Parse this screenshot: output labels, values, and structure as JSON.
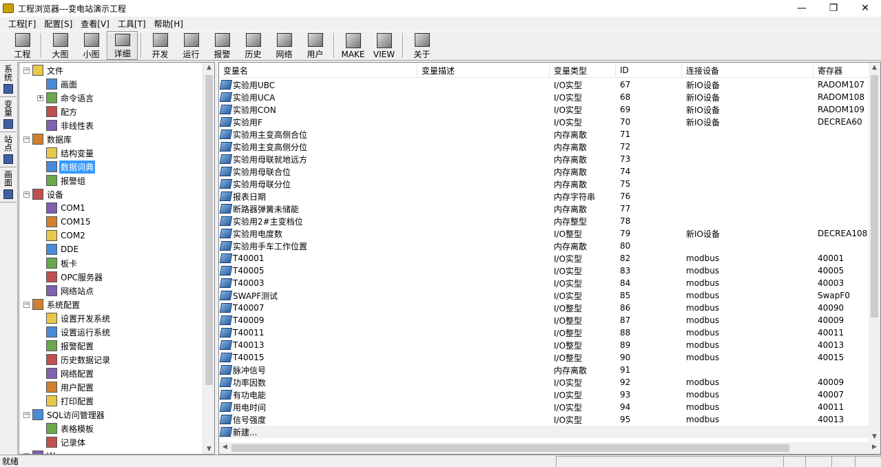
{
  "window": {
    "title": "工程浏览器---变电站演示工程",
    "min": "—",
    "max": "❐",
    "close": "✕"
  },
  "menu": [
    "工程[F]",
    "配置[S]",
    "查看[V]",
    "工具[T]",
    "帮助[H]"
  ],
  "toolbar": {
    "group1": [
      "工程"
    ],
    "group2": [
      "大图",
      "小图",
      "详细"
    ],
    "group3": [
      "开发",
      "运行",
      "报警",
      "历史",
      "网络",
      "用户"
    ],
    "group4": [
      "MAKE",
      "VIEW"
    ],
    "group5": [
      "关于"
    ],
    "active": "详细"
  },
  "side_tabs": [
    "系统",
    "变量",
    "站点",
    "画面"
  ],
  "tree": [
    {
      "label": "文件",
      "level": 0,
      "exp": "−",
      "sel": false
    },
    {
      "label": "画面",
      "level": 1,
      "exp": "",
      "sel": false
    },
    {
      "label": "命令语言",
      "level": 1,
      "exp": "+",
      "sel": false
    },
    {
      "label": "配方",
      "level": 1,
      "exp": "",
      "sel": false
    },
    {
      "label": "非线性表",
      "level": 1,
      "exp": "",
      "sel": false
    },
    {
      "label": "数据库",
      "level": 0,
      "exp": "−",
      "sel": false
    },
    {
      "label": "结构变量",
      "level": 1,
      "exp": "",
      "sel": false
    },
    {
      "label": "数据词典",
      "level": 1,
      "exp": "",
      "sel": true
    },
    {
      "label": "报警组",
      "level": 1,
      "exp": "",
      "sel": false
    },
    {
      "label": "设备",
      "level": 0,
      "exp": "−",
      "sel": false
    },
    {
      "label": "COM1",
      "level": 1,
      "exp": "",
      "sel": false
    },
    {
      "label": "COM15",
      "level": 1,
      "exp": "",
      "sel": false
    },
    {
      "label": "COM2",
      "level": 1,
      "exp": "",
      "sel": false
    },
    {
      "label": "DDE",
      "level": 1,
      "exp": "",
      "sel": false
    },
    {
      "label": "板卡",
      "level": 1,
      "exp": "",
      "sel": false
    },
    {
      "label": "OPC服务器",
      "level": 1,
      "exp": "",
      "sel": false
    },
    {
      "label": "网络站点",
      "level": 1,
      "exp": "",
      "sel": false
    },
    {
      "label": "系统配置",
      "level": 0,
      "exp": "−",
      "sel": false
    },
    {
      "label": "设置开发系统",
      "level": 1,
      "exp": "",
      "sel": false
    },
    {
      "label": "设置运行系统",
      "level": 1,
      "exp": "",
      "sel": false
    },
    {
      "label": "报警配置",
      "level": 1,
      "exp": "",
      "sel": false
    },
    {
      "label": "历史数据记录",
      "level": 1,
      "exp": "",
      "sel": false
    },
    {
      "label": "网络配置",
      "level": 1,
      "exp": "",
      "sel": false
    },
    {
      "label": "用户配置",
      "level": 1,
      "exp": "",
      "sel": false
    },
    {
      "label": "打印配置",
      "level": 1,
      "exp": "",
      "sel": false
    },
    {
      "label": "SQL访问管理器",
      "level": 0,
      "exp": "−",
      "sel": false
    },
    {
      "label": "表格模板",
      "level": 1,
      "exp": "",
      "sel": false
    },
    {
      "label": "记录体",
      "level": 1,
      "exp": "",
      "sel": false
    },
    {
      "label": "W...",
      "level": 0,
      "exp": "+",
      "sel": false
    }
  ],
  "table": {
    "columns": [
      "变量名",
      "变量描述",
      "变量类型",
      "ID",
      "连接设备",
      "寄存器"
    ],
    "rows": [
      [
        "实验用UBC",
        "",
        "I/O实型",
        "67",
        "新IO设备",
        "RADOM107"
      ],
      [
        "实验用UCA",
        "",
        "I/O实型",
        "68",
        "新IO设备",
        "RADOM108"
      ],
      [
        "实验用CON",
        "",
        "I/O实型",
        "69",
        "新IO设备",
        "RADOM109"
      ],
      [
        "实验用F",
        "",
        "I/O实型",
        "70",
        "新IO设备",
        "DECREA60"
      ],
      [
        "实验用主变高侧合位",
        "",
        "内存离散",
        "71",
        "",
        ""
      ],
      [
        "实验用主变高侧分位",
        "",
        "内存离散",
        "72",
        "",
        ""
      ],
      [
        "实验用母联就地远方",
        "",
        "内存离散",
        "73",
        "",
        ""
      ],
      [
        "实验用母联合位",
        "",
        "内存离散",
        "74",
        "",
        ""
      ],
      [
        "实验用母联分位",
        "",
        "内存离散",
        "75",
        "",
        ""
      ],
      [
        "报表日期",
        "",
        "内存字符串",
        "76",
        "",
        ""
      ],
      [
        "断路器弹簧未储能",
        "",
        "内存离散",
        "77",
        "",
        ""
      ],
      [
        "实验用2#主变档位",
        "",
        "内存整型",
        "78",
        "",
        ""
      ],
      [
        "实验用电度数",
        "",
        "I/O整型",
        "79",
        "新IO设备",
        "DECREA108"
      ],
      [
        "实验用手车工作位置",
        "",
        "内存离散",
        "80",
        "",
        ""
      ],
      [
        "T40001",
        "",
        "I/O实型",
        "82",
        "modbus",
        "40001"
      ],
      [
        "T40005",
        "",
        "I/O实型",
        "83",
        "modbus",
        "40005"
      ],
      [
        "T40003",
        "",
        "I/O实型",
        "84",
        "modbus",
        "40003"
      ],
      [
        "SWAPF测试",
        "",
        "I/O实型",
        "85",
        "modbus",
        "SwapF0"
      ],
      [
        "T40007",
        "",
        "I/O整型",
        "86",
        "modbus",
        "40090"
      ],
      [
        "T40009",
        "",
        "I/O整型",
        "87",
        "modbus",
        "40009"
      ],
      [
        "T40011",
        "",
        "I/O整型",
        "88",
        "modbus",
        "40011"
      ],
      [
        "T40013",
        "",
        "I/O整型",
        "89",
        "modbus",
        "40013"
      ],
      [
        "T40015",
        "",
        "I/O整型",
        "90",
        "modbus",
        "40015"
      ],
      [
        "脉冲信号",
        "",
        "内存离散",
        "91",
        "",
        ""
      ],
      [
        "功率因数",
        "",
        "I/O实型",
        "92",
        "modbus",
        "40009"
      ],
      [
        "有功电能",
        "",
        "I/O实型",
        "93",
        "modbus",
        "40007"
      ],
      [
        "用电时间",
        "",
        "I/O实型",
        "94",
        "modbus",
        "40011"
      ],
      [
        "信号强度",
        "",
        "I/O实型",
        "95",
        "modbus",
        "40013"
      ]
    ],
    "new_row": "新建..."
  },
  "status": {
    "text": "就绪"
  }
}
